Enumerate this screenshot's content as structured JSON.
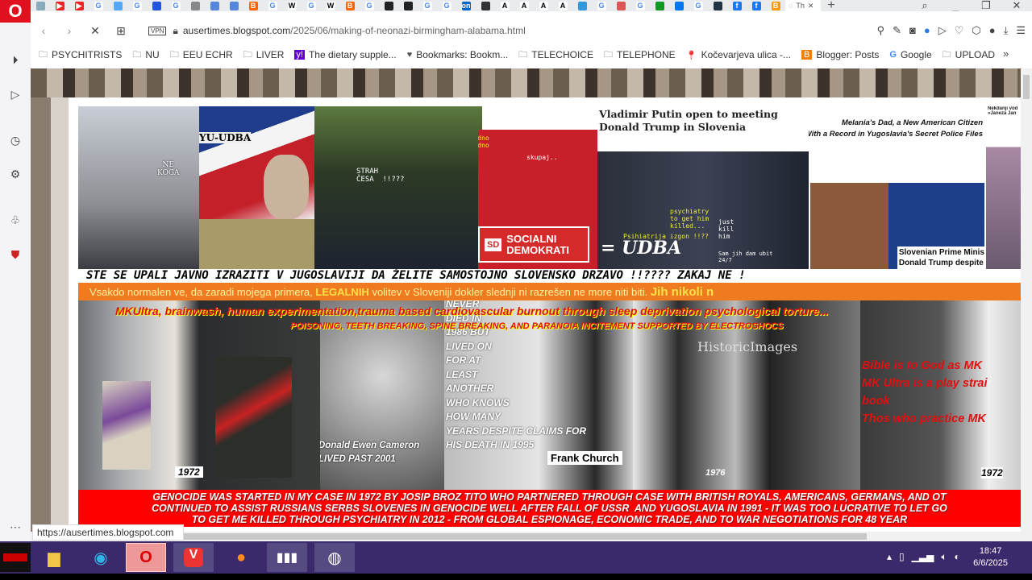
{
  "browser": {
    "tabs": [
      {
        "c": "#8ab"
      },
      {
        "c": "#e22",
        "t": "▶"
      },
      {
        "c": "#e22",
        "t": "▶"
      },
      {
        "c": "#fff",
        "t": "G",
        "tc": "#4285f4"
      },
      {
        "c": "#5af"
      },
      {
        "c": "#fff",
        "t": "G",
        "tc": "#4285f4"
      },
      {
        "c": "#25d"
      },
      {
        "c": "#fff",
        "t": "G",
        "tc": "#4285f4"
      },
      {
        "c": "#888"
      },
      {
        "c": "#58d"
      },
      {
        "c": "#58d"
      },
      {
        "c": "#f60",
        "t": "B"
      },
      {
        "c": "#fff",
        "t": "G",
        "tc": "#4285f4"
      },
      {
        "c": "#fff",
        "t": "W",
        "tc": "#000"
      },
      {
        "c": "#fff",
        "t": "G",
        "tc": "#4285f4"
      },
      {
        "c": "#fff",
        "t": "W",
        "tc": "#000"
      },
      {
        "c": "#f60",
        "t": "B"
      },
      {
        "c": "#fff",
        "t": "G",
        "tc": "#4285f4"
      },
      {
        "c": "#222"
      },
      {
        "c": "#222"
      },
      {
        "c": "#fff",
        "t": "G",
        "tc": "#4285f4"
      },
      {
        "c": "#fff",
        "t": "G",
        "tc": "#4285f4"
      },
      {
        "c": "#06c",
        "t": "on"
      },
      {
        "c": "#333"
      },
      {
        "c": "#fff",
        "t": "A",
        "tc": "#000"
      },
      {
        "c": "#fff",
        "t": "A",
        "tc": "#000"
      },
      {
        "c": "#fff",
        "t": "A",
        "tc": "#000"
      },
      {
        "c": "#fff",
        "t": "A",
        "tc": "#000"
      },
      {
        "c": "#39d"
      },
      {
        "c": "#fff",
        "t": "G",
        "tc": "#4285f4"
      },
      {
        "c": "#d55"
      },
      {
        "c": "#fff",
        "t": "G",
        "tc": "#4285f4"
      },
      {
        "c": "#192"
      },
      {
        "c": "#07e"
      },
      {
        "c": "#fff",
        "t": "G",
        "tc": "#4285f4"
      },
      {
        "c": "#234"
      },
      {
        "c": "#1877f2",
        "t": "f"
      },
      {
        "c": "#1877f2",
        "t": "f"
      },
      {
        "c": "#f90",
        "t": "B"
      }
    ],
    "active_tab_label": "Th",
    "url_domain": "ausertimes.blogspot.com",
    "url_path": "/2025/06/making-of-neonazi-birmingham-alabama.html",
    "vpn_label": "VPN",
    "bookmarks": [
      {
        "icon": "folder-icon",
        "label": "PSYCHITRISTS"
      },
      {
        "icon": "folder-icon",
        "label": "NU"
      },
      {
        "icon": "folder-icon",
        "label": "EEU ECHR"
      },
      {
        "icon": "folder-icon",
        "label": "LIVER"
      },
      {
        "icon": "yahoo-icon",
        "label": "The dietary supple..."
      },
      {
        "icon": "heart-icon",
        "label": "Bookmarks: Bookm..."
      },
      {
        "icon": "folder-icon",
        "label": "TELECHOICE"
      },
      {
        "icon": "folder-icon",
        "label": "TELEPHONE"
      },
      {
        "icon": "maps-pin-icon",
        "label": "Kočevarjeva ulica -..."
      },
      {
        "icon": "blogger-icon",
        "label": "Blogger: Posts"
      },
      {
        "icon": "google-icon",
        "label": "Google"
      },
      {
        "icon": "folder-icon",
        "label": "UPLOAD"
      }
    ],
    "status_url": "https://ausertimes.blogspot.com"
  },
  "page": {
    "top_images": {
      "ne_koga": "NE\nKOGA",
      "yu_udba": "YU-UDBA",
      "strah": "STRAH\nČESA  !!???",
      "zajedno": "zajedno\nzajedno",
      "skupaj": "skupaj..",
      "sd_logo": "SD",
      "sd_name": "SOCIALNI\nDEMOKRATI",
      "putin_headline": "Vladimir Putin open to meeting Donald Trump in Slovenia",
      "psychiatry": "psychiatry\nto get him\nkilled...",
      "psihiatrija": "Psihiatrija izgon !!??",
      "just_kill": "just\nkill\nhim",
      "sam_jih": "Sam jih dam ubit\n24/7",
      "udba": "= UDBA",
      "melania_headline": "Melania's Dad, a New American Citizen\nWith a Record in Yugoslavia's Secret Police Files",
      "slovenian_pm": "Slovenian Prime Minis\nDonald Trump despite",
      "nekdanji": "Nekdanji vod\n»Janeza Jan"
    },
    "banner_black": "STE SE UPALI JAVNO IZRAZITI V JUGOSLAVIJI DA ŽELITE SAMOSTOJNO SLOVENSKO DRZAVO !!???? ZAKAJ NE !",
    "banner_orange_a": "Vsakdo normalen ve, da zaradi mojega primera, ",
    "banner_orange_b": "LEGALNIH",
    "banner_orange_c": "  volitev v Sloveniji dokler slednji ni razrešen ne more niti biti. ",
    "banner_orange_d": "Jih nikoli n",
    "mkultra_line1": "MKUltra, brainwash, human experimentation,trauma based cardiovascular burnout through sleep deprivation psychological torture...",
    "mkultra_line2": "POISONING, TEETH BREAKING, SPINE BREAKING, AND PARANOIA INCITEMENT SUPPORTED BY ELECTROSHOCS",
    "year_1972_a": "1972",
    "cameron": "Donald Ewen Cameron\nLIVED PAST 2001",
    "never_died": "NEVER\nDIED IN\n1986 BUT\nLIVED ON\nFOR AT\nLEAST\nANOTHER\nWHO KNOWS\nHOW MANY\nYEARS DESPITE CLAIMS FOR\nHIS DEATH IN 1995",
    "frank_church": "Frank Church",
    "historic_images": "HistoricImages",
    "year_1976": "1976",
    "bible": "Bible is to God as MK\nMK Ultra is a play strai\nbook\nThos who practice MK",
    "year_1972_b": "1972",
    "genocide": "GENOCIDE WAS STARTED IN MY CASE IN 1972 BY JOSIP BROZ TITO WHO PARTNERED THROUGH CASE WITH BRITISH ROYALS, AMERICANS, GERMANS, AND OT\nCONTINUED TO ASSIST RUSSIANS SERBS SLOVENES IN GENOCIDE WELL AFTER FALL OF USSR  AND YUGOSLAVIA IN 1991 - IT WAS TOO LUCRATIVE TO LET GO\nTO GET ME KILLED THROUGH PSYCHIATRY IN 2012 - FROM GLOBAL ESPIONAGE, ECONOMIC TRADE, AND TO WAR NEGOTIATIONS FOR 48 YEAR"
  },
  "taskbar": {
    "time": "18:47",
    "date": "6/6/2025"
  }
}
